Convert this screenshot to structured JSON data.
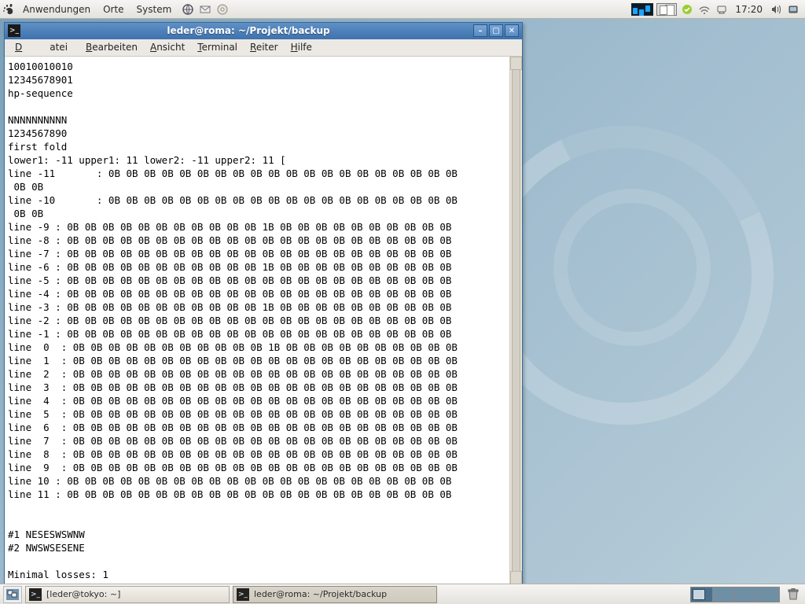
{
  "top_panel": {
    "menus": [
      "Anwendungen",
      "Orte",
      "System"
    ],
    "clock": "17:20"
  },
  "taskbar": {
    "task1": "[leder@tokyo: ~]",
    "task2": "leder@roma: ~/Projekt/backup"
  },
  "window": {
    "title": "leder@roma: ~/Projekt/backup",
    "menus": {
      "m1": "Datei",
      "m2": "Bearbeiten",
      "m3": "Ansicht",
      "m4": "Terminal",
      "m5": "Reiter",
      "m6": "Hilfe"
    }
  },
  "terminal_lines": [
    "10010010010",
    "12345678901",
    "hp-sequence",
    "",
    "NNNNNNNNNN",
    "1234567890",
    "first fold",
    "lower1: -11 upper1: 11 lower2: -11 upper2: 11 [",
    "line -11       : 0B 0B 0B 0B 0B 0B 0B 0B 0B 0B 0B 0B 0B 0B 0B 0B 0B 0B 0B 0B",
    " 0B 0B",
    "line -10       : 0B 0B 0B 0B 0B 0B 0B 0B 0B 0B 0B 0B 0B 0B 0B 0B 0B 0B 0B 0B",
    " 0B 0B",
    "line -9 : 0B 0B 0B 0B 0B 0B 0B 0B 0B 0B 0B 1B 0B 0B 0B 0B 0B 0B 0B 0B 0B 0B",
    "line -8 : 0B 0B 0B 0B 0B 0B 0B 0B 0B 0B 0B 0B 0B 0B 0B 0B 0B 0B 0B 0B 0B 0B",
    "line -7 : 0B 0B 0B 0B 0B 0B 0B 0B 0B 0B 0B 0B 0B 0B 0B 0B 0B 0B 0B 0B 0B 0B",
    "line -6 : 0B 0B 0B 0B 0B 0B 0B 0B 0B 0B 0B 1B 0B 0B 0B 0B 0B 0B 0B 0B 0B 0B",
    "line -5 : 0B 0B 0B 0B 0B 0B 0B 0B 0B 0B 0B 0B 0B 0B 0B 0B 0B 0B 0B 0B 0B 0B",
    "line -4 : 0B 0B 0B 0B 0B 0B 0B 0B 0B 0B 0B 0B 0B 0B 0B 0B 0B 0B 0B 0B 0B 0B",
    "line -3 : 0B 0B 0B 0B 0B 0B 0B 0B 0B 0B 0B 1B 0B 0B 0B 0B 0B 0B 0B 0B 0B 0B",
    "line -2 : 0B 0B 0B 0B 0B 0B 0B 0B 0B 0B 0B 0B 0B 0B 0B 0B 0B 0B 0B 0B 0B 0B",
    "line -1 : 0B 0B 0B 0B 0B 0B 0B 0B 0B 0B 0B 0B 0B 0B 0B 0B 0B 0B 0B 0B 0B 0B",
    "line  0  : 0B 0B 0B 0B 0B 0B 0B 0B 0B 0B 0B 1B 0B 0B 0B 0B 0B 0B 0B 0B 0B 0B",
    "line  1  : 0B 0B 0B 0B 0B 0B 0B 0B 0B 0B 0B 0B 0B 0B 0B 0B 0B 0B 0B 0B 0B 0B",
    "line  2  : 0B 0B 0B 0B 0B 0B 0B 0B 0B 0B 0B 0B 0B 0B 0B 0B 0B 0B 0B 0B 0B 0B",
    "line  3  : 0B 0B 0B 0B 0B 0B 0B 0B 0B 0B 0B 0B 0B 0B 0B 0B 0B 0B 0B 0B 0B 0B",
    "line  4  : 0B 0B 0B 0B 0B 0B 0B 0B 0B 0B 0B 0B 0B 0B 0B 0B 0B 0B 0B 0B 0B 0B",
    "line  5  : 0B 0B 0B 0B 0B 0B 0B 0B 0B 0B 0B 0B 0B 0B 0B 0B 0B 0B 0B 0B 0B 0B",
    "line  6  : 0B 0B 0B 0B 0B 0B 0B 0B 0B 0B 0B 0B 0B 0B 0B 0B 0B 0B 0B 0B 0B 0B",
    "line  7  : 0B 0B 0B 0B 0B 0B 0B 0B 0B 0B 0B 0B 0B 0B 0B 0B 0B 0B 0B 0B 0B 0B",
    "line  8  : 0B 0B 0B 0B 0B 0B 0B 0B 0B 0B 0B 0B 0B 0B 0B 0B 0B 0B 0B 0B 0B 0B",
    "line  9  : 0B 0B 0B 0B 0B 0B 0B 0B 0B 0B 0B 0B 0B 0B 0B 0B 0B 0B 0B 0B 0B 0B",
    "line 10 : 0B 0B 0B 0B 0B 0B 0B 0B 0B 0B 0B 0B 0B 0B 0B 0B 0B 0B 0B 0B 0B 0B",
    "line 11 : 0B 0B 0B 0B 0B 0B 0B 0B 0B 0B 0B 0B 0B 0B 0B 0B 0B 0B 0B 0B 0B 0B",
    "",
    "",
    "#1 NESESWSWNW",
    "#2 NWSWSESENE",
    "",
    "Minimal losses: 1"
  ]
}
